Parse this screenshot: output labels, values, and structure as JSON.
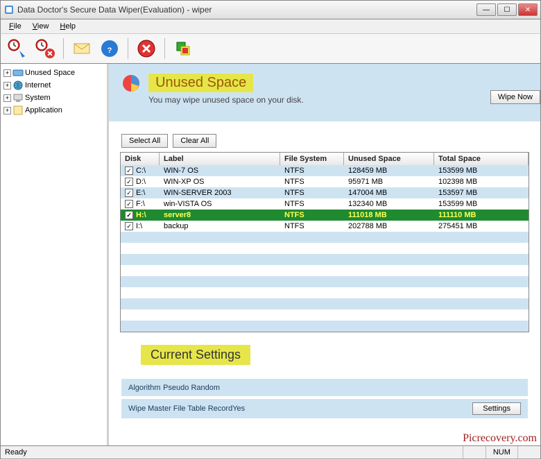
{
  "window": {
    "title": "Data Doctor's Secure Data Wiper(Evaluation) - wiper"
  },
  "menu": {
    "file": "File",
    "view": "View",
    "help": "Help"
  },
  "sidebar": {
    "items": [
      {
        "label": "Unused Space"
      },
      {
        "label": "Internet"
      },
      {
        "label": "System"
      },
      {
        "label": "Application"
      }
    ]
  },
  "header": {
    "title": "Unused Space",
    "subtitle": "You may wipe unused space on your disk.",
    "wipe_now": "Wipe Now"
  },
  "actions": {
    "select_all": "Select All",
    "clear_all": "Clear All"
  },
  "table": {
    "columns": {
      "disk": "Disk",
      "label": "Label",
      "fs": "File System",
      "unused": "Unused Space",
      "total": "Total Space"
    },
    "rows": [
      {
        "checked": true,
        "disk": "C:\\",
        "label": "WIN-7 OS",
        "fs": "NTFS",
        "unused": "128459 MB",
        "total": "153599 MB",
        "selected": false
      },
      {
        "checked": true,
        "disk": "D:\\",
        "label": "WIN-XP OS",
        "fs": "NTFS",
        "unused": "95971 MB",
        "total": "102398 MB",
        "selected": false
      },
      {
        "checked": true,
        "disk": "E:\\",
        "label": "WIN-SERVER 2003",
        "fs": "NTFS",
        "unused": "147004 MB",
        "total": "153597 MB",
        "selected": false
      },
      {
        "checked": true,
        "disk": "F:\\",
        "label": "win-VISTA OS",
        "fs": "NTFS",
        "unused": "132340 MB",
        "total": "153599 MB",
        "selected": false
      },
      {
        "checked": true,
        "disk": "H:\\",
        "label": "server8",
        "fs": "NTFS",
        "unused": "111018 MB",
        "total": "111110 MB",
        "selected": true
      },
      {
        "checked": true,
        "disk": "I:\\",
        "label": "backup",
        "fs": "NTFS",
        "unused": "202788 MB",
        "total": "275451 MB",
        "selected": false
      }
    ]
  },
  "settings": {
    "title": "Current Settings",
    "algorithm_label": "Algorithm",
    "algorithm_value": "Pseudo Random",
    "wipe_mft_label": "Wipe Master File Table Record",
    "wipe_mft_value": "Yes",
    "button": "Settings"
  },
  "statusbar": {
    "ready": "Ready",
    "num": "NUM"
  },
  "watermark": "Picrecovery.com"
}
